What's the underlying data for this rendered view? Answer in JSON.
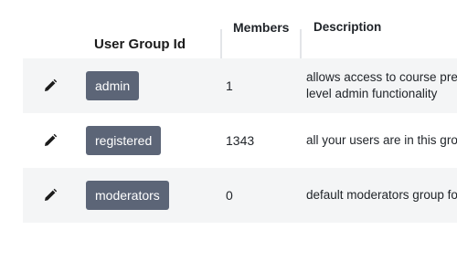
{
  "table": {
    "columns": {
      "id": "User Group Id",
      "members": "Members",
      "description": "Description"
    },
    "rows": [
      {
        "group_id": "admin",
        "members": "1",
        "description": "allows access to course previ… level admin functionality",
        "description_line1": "allows access to course previ",
        "description_line2": "level admin functionality"
      },
      {
        "group_id": "registered",
        "members": "1343",
        "description": "all your users are in this grou"
      },
      {
        "group_id": "moderators",
        "members": "0",
        "description": "default moderators group for"
      }
    ]
  },
  "icons": {
    "edit": "pencil-icon"
  },
  "colors": {
    "badge_bg": "#5c6577",
    "row_shade": "#f4f5f6",
    "separator": "#e3e5e8"
  }
}
